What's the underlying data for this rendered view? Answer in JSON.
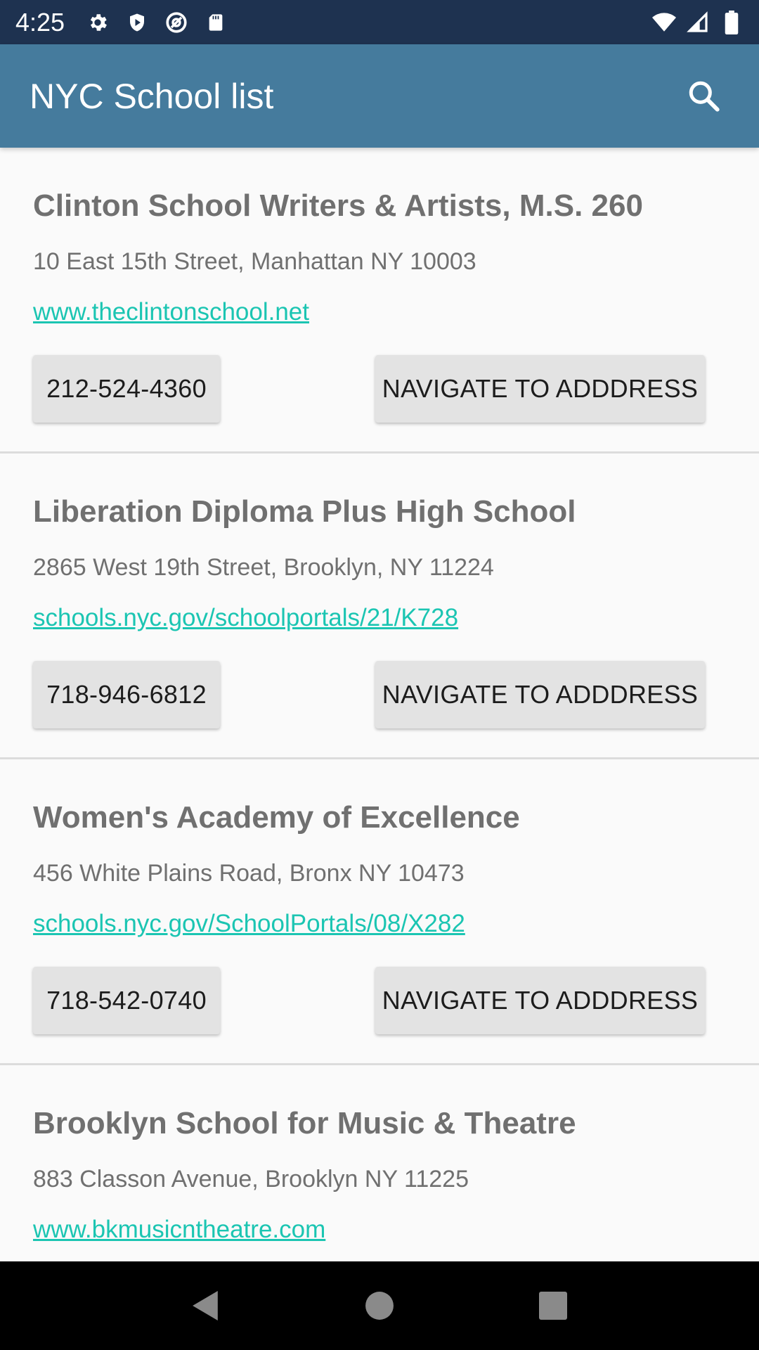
{
  "status_bar": {
    "time": "4:25",
    "icons_left": [
      "settings-icon",
      "shield-icon",
      "at-sign-icon",
      "sd-card-icon"
    ],
    "icons_right": [
      "wifi-icon",
      "signal-icon",
      "battery-icon"
    ]
  },
  "app_bar": {
    "title": "NYC School list",
    "search_icon": "search-icon",
    "color": "#457b9d"
  },
  "schools": [
    {
      "name": "Clinton School Writers & Artists, M.S. 260",
      "address": "10 East 15th Street, Manhattan NY 10003",
      "website": "www.theclintonschool.net",
      "phone": "212-524-4360",
      "navigate_label": "NAVIGATE TO ADDDRESS"
    },
    {
      "name": "Liberation Diploma Plus High School",
      "address": "2865 West 19th Street, Brooklyn, NY 11224",
      "website": "schools.nyc.gov/schoolportals/21/K728",
      "phone": "718-946-6812",
      "navigate_label": "NAVIGATE TO ADDDRESS"
    },
    {
      "name": "Women's Academy of Excellence",
      "address": "456 White Plains Road, Bronx NY 10473",
      "website": "schools.nyc.gov/SchoolPortals/08/X282",
      "phone": "718-542-0740",
      "navigate_label": "NAVIGATE TO ADDDRESS"
    },
    {
      "name": "Brooklyn School for Music & Theatre",
      "address": "883 Classon Avenue, Brooklyn NY 11225",
      "website": "www.bkmusicntheatre.com"
    }
  ],
  "nav_bar": {
    "icons": [
      "back-icon",
      "home-icon",
      "recents-icon"
    ]
  },
  "colors": {
    "status_bar": "#1e3250",
    "link": "#1bc5b2",
    "text_muted": "#707070",
    "button_bg": "#e3e3e3"
  }
}
